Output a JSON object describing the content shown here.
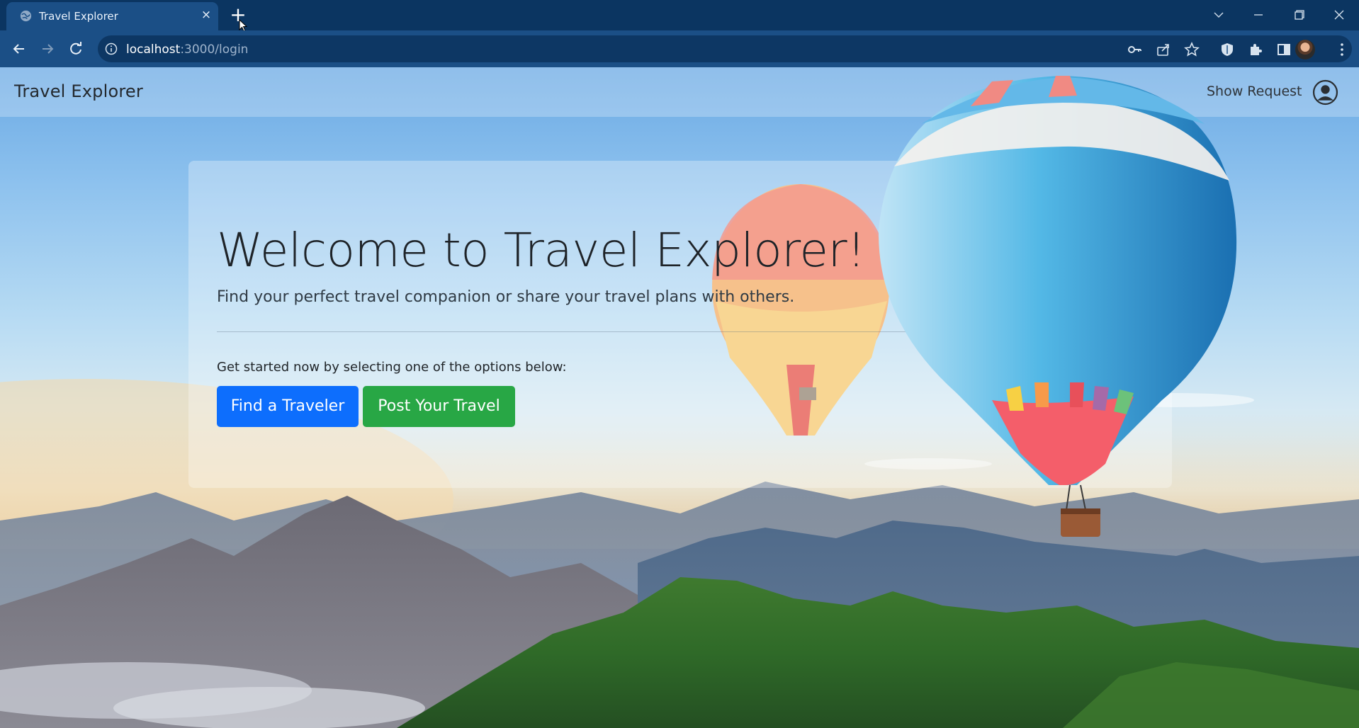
{
  "browser": {
    "tab_title": "Travel Explorer",
    "tab_close_glyph": "×",
    "new_tab_glyph": "+",
    "url_host": "localhost",
    "url_path": ":3000/login",
    "icons": [
      "globe-icon",
      "close-icon",
      "plus-icon",
      "chevron-down-icon",
      "minimize-icon",
      "restore-icon",
      "close-window-icon",
      "back-icon",
      "forward-icon",
      "reload-icon",
      "info-icon",
      "key-icon",
      "share-icon",
      "star-icon",
      "shield-icon",
      "puzzle-icon",
      "sidebar-icon",
      "profile-avatar",
      "menu-icon"
    ]
  },
  "navbar": {
    "brand": "Travel Explorer",
    "show_request": "Show Request",
    "user_icon": "user-circle-icon"
  },
  "hero": {
    "title": "Welcome to Travel Explorer!",
    "lead": "Find your perfect travel companion or share your travel plans with others.",
    "prompt": "Get started now by selecting one of the options below:",
    "find_button": "Find a Traveler",
    "post_button": "Post Your Travel"
  },
  "colors": {
    "chrome_dark": "#0b3561",
    "chrome_tab": "#1b4f86",
    "primary": "#0d6efd",
    "success": "#28a745"
  }
}
